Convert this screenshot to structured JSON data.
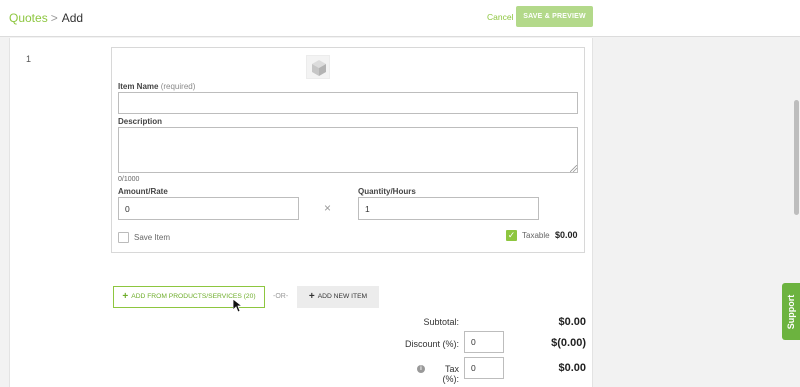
{
  "breadcrumb": {
    "parent": "Quotes",
    "separator": ">",
    "current": "Add"
  },
  "header": {
    "cancel_label": "Cancel",
    "save_label": "SAVE & PREVIEW"
  },
  "line_item": {
    "number": "1",
    "item_name_label": "Item Name",
    "item_name_required": "(required)",
    "item_name_value": "",
    "description_label": "Description",
    "description_value": "",
    "char_counter": "0/1000",
    "amount_label": "Amount/Rate",
    "amount_value": "0",
    "multiply_symbol": "×",
    "quantity_label": "Quantity/Hours",
    "quantity_value": "1",
    "save_item_label": "Save Item",
    "save_item_checked": false,
    "taxable_label": "Taxable",
    "taxable_checked": true,
    "line_total": "$0.00",
    "image_icon": "box-icon"
  },
  "actions": {
    "add_from_products_label": "ADD FROM PRODUCTS/SERVICES (20)",
    "or_label": "-OR-",
    "add_new_item_label": "ADD NEW ITEM"
  },
  "summary": {
    "subtotal_label": "Subtotal:",
    "subtotal_value": "$0.00",
    "discount_label": "Discount (%):",
    "discount_input": "0",
    "discount_value": "$(0.00)",
    "tax_label": "Tax (%):",
    "tax_input": "0",
    "tax_value": "$0.00"
  },
  "support_label": "Support",
  "colors": {
    "accent": "#8dc63f",
    "accent_disabled": "#b3d98a",
    "support": "#6cb33f"
  }
}
